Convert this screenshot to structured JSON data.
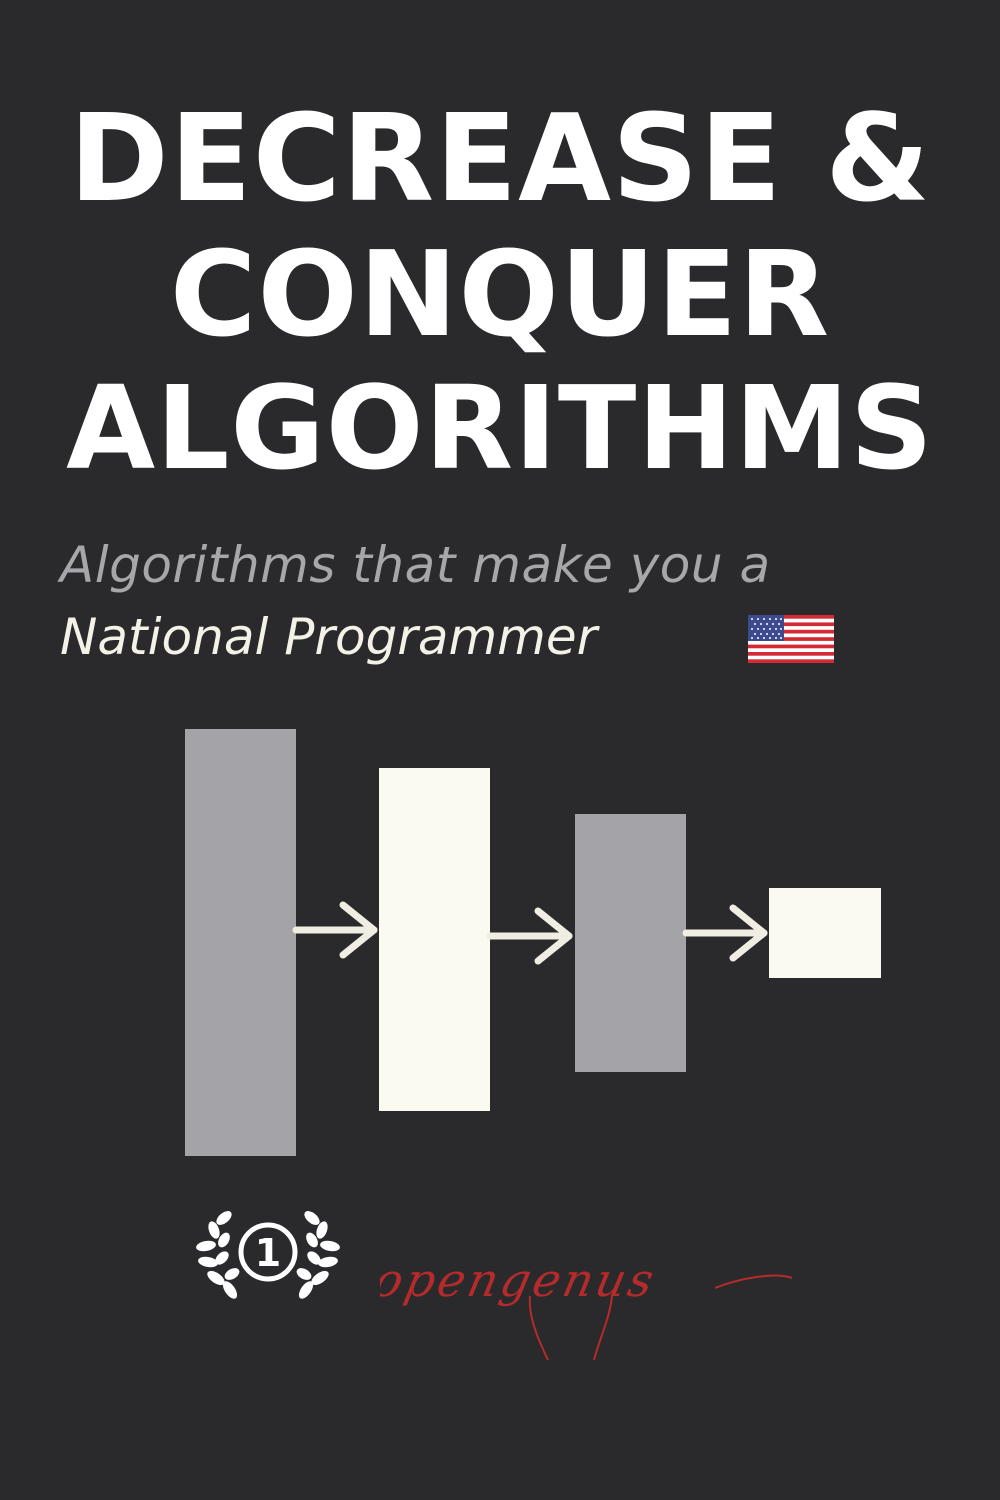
{
  "cover": {
    "title_lines": [
      "DECREASE &",
      "CONQUER",
      "ALGORITHMS"
    ],
    "subtitle_line1": "Algorithms that make you a",
    "subtitle_line2": "National Programmer",
    "brand": "opengenus",
    "badge_number": "1"
  },
  "icons": {
    "flag": "us-flag-icon",
    "badge": "laurel-wreath-icon"
  },
  "colors": {
    "background": "#2a2a2c",
    "title": "#ffffff",
    "subtitle_muted": "#a6a6ab",
    "subtitle_light": "#f4f1e6",
    "block_gray": "#a3a3a8",
    "block_cream": "#fafaf0",
    "brand_red": "#b52b2b"
  }
}
